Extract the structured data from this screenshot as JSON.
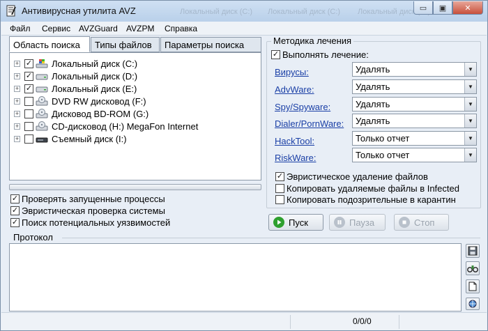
{
  "window": {
    "title": "Антивирусная утилита AVZ",
    "ghost_titles": [
      "Локальный диск (C:)",
      "Локальный диск (C:)",
      "Локальный диск (C:)"
    ],
    "close_symbol": "✕",
    "min_symbol": "▭",
    "max_symbol": "▣"
  },
  "menu": [
    "Файл",
    "Сервис",
    "AVZGuard",
    "AVZPM",
    "Справка"
  ],
  "tabs": [
    "Область поиска",
    "Типы файлов",
    "Параметры поиска"
  ],
  "tree": [
    {
      "label": "Локальный диск (C:)",
      "checked": true,
      "icon": "windows-drive-icon"
    },
    {
      "label": "Локальный диск (D:)",
      "checked": true,
      "icon": "hard-drive-icon"
    },
    {
      "label": "Локальный диск (E:)",
      "checked": true,
      "icon": "hard-drive-icon"
    },
    {
      "label": "DVD RW дисковод (F:)",
      "checked": false,
      "icon": "optical-drive-icon"
    },
    {
      "label": "Дисковод BD-ROM (G:)",
      "checked": false,
      "icon": "optical-drive-icon"
    },
    {
      "label": "CD-дисковод (H:) MegaFon Internet",
      "checked": false,
      "icon": "optical-drive-icon"
    },
    {
      "label": "Съемный диск (I:)",
      "checked": false,
      "icon": "removable-drive-icon"
    }
  ],
  "tree_expander": "+",
  "left_options": [
    {
      "label": "Проверять запущенные процессы",
      "checked": true
    },
    {
      "label": "Эвристическая проверка системы",
      "checked": true
    },
    {
      "label": "Поиск потенциальных уязвимостей",
      "checked": true
    }
  ],
  "treatment": {
    "group_title": "Методика лечения",
    "perform_label": "Выполнять лечение:",
    "perform_checked": true,
    "rows": [
      {
        "label": "Вирусы:",
        "value": "Удалять"
      },
      {
        "label": "AdvWare:",
        "value": "Удалять"
      },
      {
        "label": "Spy/Spyware:",
        "value": "Удалять"
      },
      {
        "label": "Dialer/PornWare:",
        "value": "Удалять"
      },
      {
        "label": "HackTool:",
        "value": "Только отчет"
      },
      {
        "label": "RiskWare:",
        "value": "Только отчет"
      }
    ],
    "dropdown_arrow": "▼",
    "extra_options": [
      {
        "label": "Эвристическое удаление файлов",
        "checked": true
      },
      {
        "label": "Копировать удаляемые файлы в  Infected",
        "checked": false
      },
      {
        "label": "Копировать подозрительные в  карантин",
        "checked": false
      }
    ]
  },
  "buttons": {
    "start": "Пуск",
    "pause": "Пауза",
    "stop": "Стоп"
  },
  "protocol": {
    "title": "Протокол"
  },
  "status": {
    "counter": "0/0/0"
  },
  "colors": {
    "link": "#1a3fa6",
    "start_icon": "#2ea02e"
  }
}
